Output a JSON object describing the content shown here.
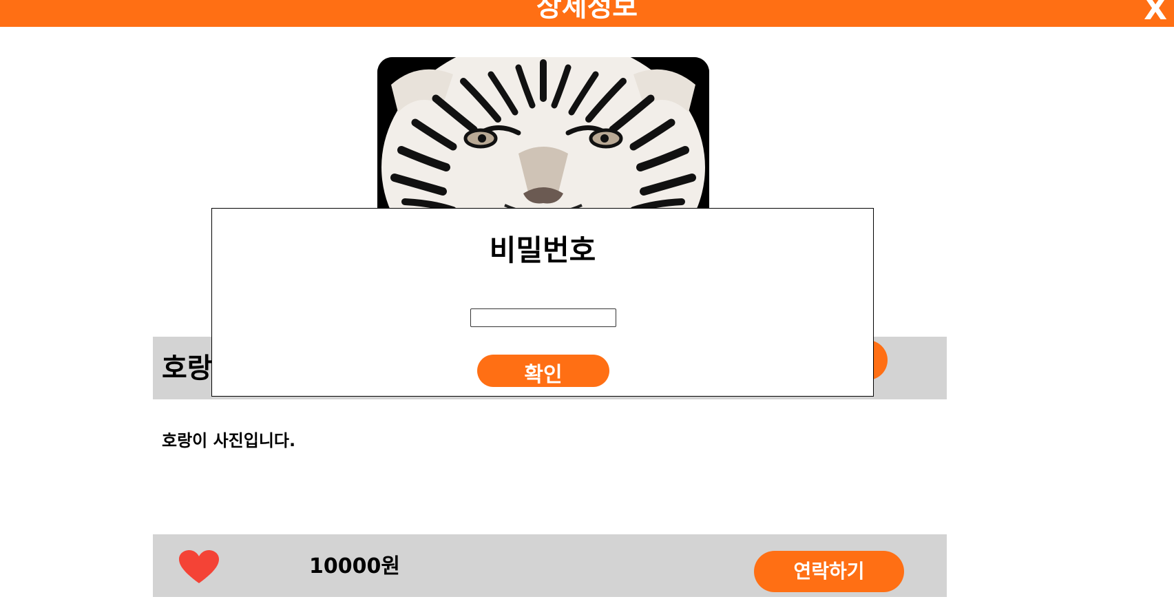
{
  "header": {
    "title": "상세정보",
    "close_label": "X",
    "color": "#ff6f14"
  },
  "product": {
    "image_icon": "tiger-photo",
    "title": "호랑",
    "description": "호랑이 사진입니다.",
    "price": "10000원",
    "like_icon": "heart-icon",
    "like_color": "#f44336",
    "contact_label": "연락하기"
  },
  "password_modal": {
    "title": "비밀번호",
    "input_value": "",
    "input_placeholder": "",
    "confirm_label": "확인"
  }
}
